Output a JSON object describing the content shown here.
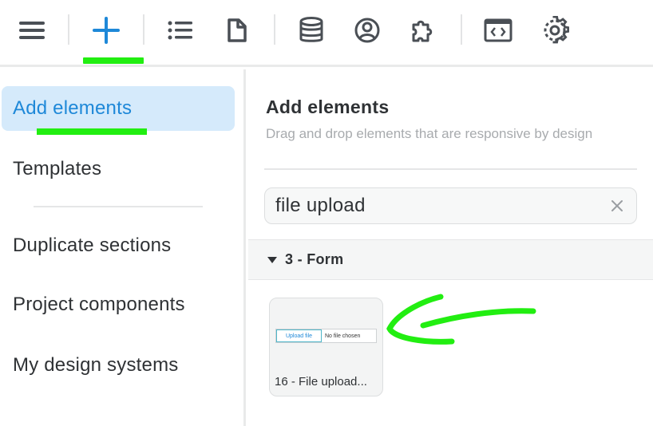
{
  "toolbar": {
    "icons": [
      "menu-icon",
      "add-icon",
      "list-icon",
      "page-icon",
      "database-icon",
      "user-circle-icon",
      "puzzle-icon",
      "code-icon",
      "gear-icon"
    ],
    "active": "add-icon",
    "accent": "#1e88d8",
    "highlight": "#22ee11"
  },
  "sidebar": {
    "items": [
      {
        "label": "Add elements",
        "active": true
      },
      {
        "label": "Templates"
      },
      {
        "label": "Duplicate sections"
      },
      {
        "label": "Project components"
      },
      {
        "label": "My design systems"
      }
    ]
  },
  "main": {
    "title": "Add elements",
    "subtitle": "Drag and drop elements that are responsive by design",
    "search": {
      "value": "file upload",
      "clear_icon": "close-icon"
    },
    "category": {
      "label": "3 - Form",
      "expanded": true
    },
    "cards": [
      {
        "label": "16 - File upload...",
        "preview_button": "Upload file",
        "preview_text": "No file chosen"
      }
    ]
  }
}
